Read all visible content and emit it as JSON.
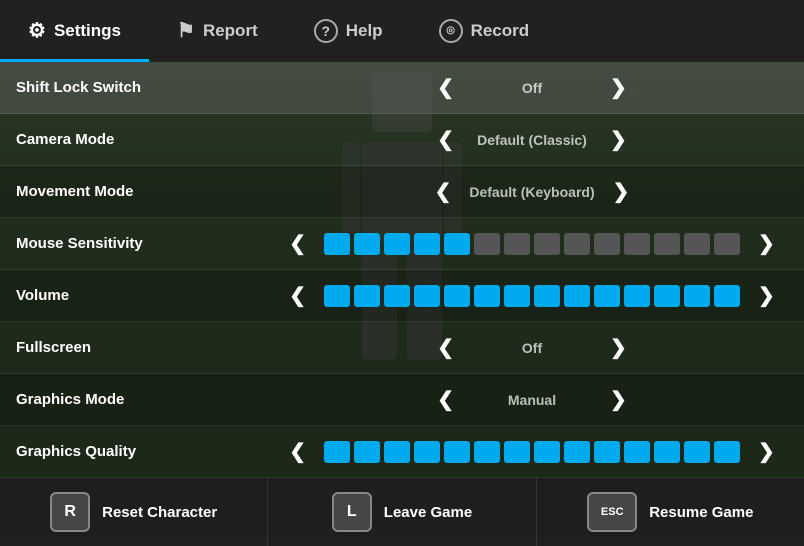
{
  "nav": {
    "items": [
      {
        "id": "settings",
        "label": "Settings",
        "icon": "⚙",
        "active": true
      },
      {
        "id": "report",
        "label": "Report",
        "icon": "⚑",
        "active": false
      },
      {
        "id": "help",
        "label": "Help",
        "icon": "?",
        "active": false
      },
      {
        "id": "record",
        "label": "Record",
        "icon": "◎",
        "active": false
      }
    ]
  },
  "settings": [
    {
      "id": "shift-lock",
      "label": "Shift Lock Switch",
      "type": "value",
      "value": "Off"
    },
    {
      "id": "camera-mode",
      "label": "Camera Mode",
      "type": "value",
      "value": "Default (Classic)"
    },
    {
      "id": "movement-mode",
      "label": "Movement Mode",
      "type": "value",
      "value": "Default (Keyboard)"
    },
    {
      "id": "mouse-sensitivity",
      "label": "Mouse Sensitivity",
      "type": "slider",
      "total_bars": 14,
      "active_bars": 5
    },
    {
      "id": "volume",
      "label": "Volume",
      "type": "slider",
      "total_bars": 14,
      "active_bars": 14
    },
    {
      "id": "fullscreen",
      "label": "Fullscreen",
      "type": "value",
      "value": "Off"
    },
    {
      "id": "graphics-mode",
      "label": "Graphics Mode",
      "type": "value",
      "value": "Manual"
    },
    {
      "id": "graphics-quality",
      "label": "Graphics Quality",
      "type": "slider",
      "total_bars": 14,
      "active_bars": 14
    }
  ],
  "actions": [
    {
      "id": "reset",
      "key": "R",
      "label": "Reset Character"
    },
    {
      "id": "leave",
      "key": "L",
      "label": "Leave Game"
    },
    {
      "id": "resume",
      "key": "ESC",
      "label": "Resume Game"
    }
  ],
  "colors": {
    "active_bar": "#00aaee",
    "inactive_bar": "#666666",
    "nav_active_underline": "#00aaff"
  }
}
